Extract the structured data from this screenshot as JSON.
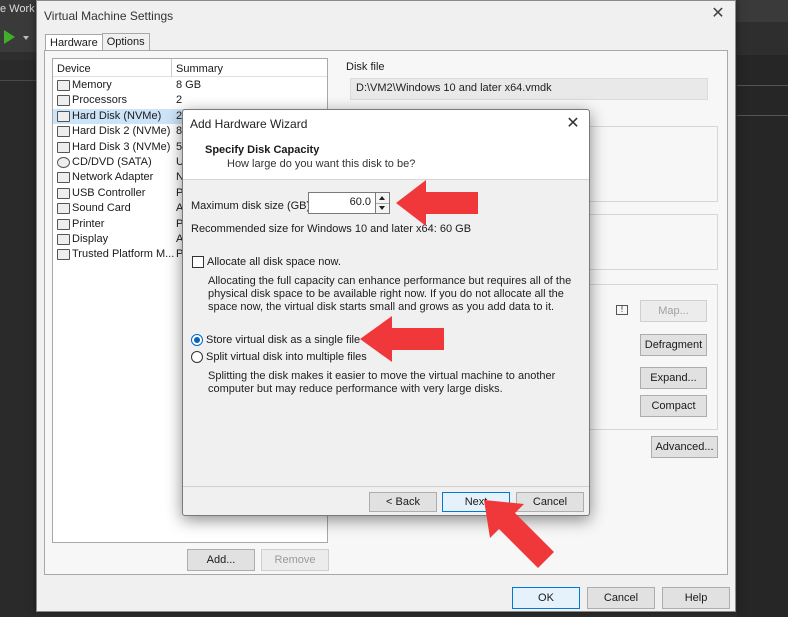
{
  "background_app": {
    "title_fragment": "e Work"
  },
  "settings_window": {
    "title": "Virtual Machine Settings",
    "tabs": [
      {
        "label": "Hardware"
      },
      {
        "label": "Options"
      }
    ],
    "device_list": {
      "headers": {
        "device": "Device",
        "summary": "Summary"
      },
      "rows": [
        {
          "device": "Memory",
          "summary": "8 GB"
        },
        {
          "device": "Processors",
          "summary": "2"
        },
        {
          "device": "Hard Disk (NVMe)",
          "summary": "2"
        },
        {
          "device": "Hard Disk 2 (NVMe)",
          "summary": "8"
        },
        {
          "device": "Hard Disk 3 (NVMe)",
          "summary": "5"
        },
        {
          "device": "CD/DVD (SATA)",
          "summary": "U"
        },
        {
          "device": "Network Adapter",
          "summary": "N"
        },
        {
          "device": "USB Controller",
          "summary": "P"
        },
        {
          "device": "Sound Card",
          "summary": "A"
        },
        {
          "device": "Printer",
          "summary": "P"
        },
        {
          "device": "Display",
          "summary": "A"
        },
        {
          "device": "Trusted Platform M...",
          "summary": "P"
        }
      ],
      "selected_index": 2
    },
    "add_label": "Add...",
    "remove_label": "Remove",
    "disk_file_label": "Disk file",
    "disk_file_path": "D:\\VM2\\Windows 10 and later x64.vmdk",
    "map_label": "Map...",
    "defragment_label": "Defragment",
    "expand_label": "Expand...",
    "compact_label": "Compact",
    "advanced_label": "Advanced...",
    "ok_label": "OK",
    "cancel_label": "Cancel",
    "help_label": "Help"
  },
  "wizard": {
    "title": "Add Hardware Wizard",
    "heading": "Specify Disk Capacity",
    "subheading": "How large do you want this disk to be?",
    "max_size_label": "Maximum disk size (GB):",
    "max_size_value": "60.0",
    "recommended_text": "Recommended size for Windows 10 and later x64: 60 GB",
    "allocate_label": "Allocate all disk space now.",
    "allocate_checked": false,
    "allocate_desc": "Allocating the full capacity can enhance performance but requires all of the physical disk space to be available right now. If you do not allocate all the space now, the virtual disk starts small and grows as you add data to it.",
    "single_file_label": "Store virtual disk as a single file",
    "multi_file_label": "Split virtual disk into multiple files",
    "selected_storage": "single",
    "split_desc": "Splitting the disk makes it easier to move the virtual machine to another computer but may reduce performance with very large disks.",
    "back_label": "< Back",
    "next_label": "Next",
    "cancel_label": "Cancel"
  },
  "colors": {
    "arrow": "#f0383b",
    "accent": "#0078d7",
    "selection": "#cce4f7"
  }
}
